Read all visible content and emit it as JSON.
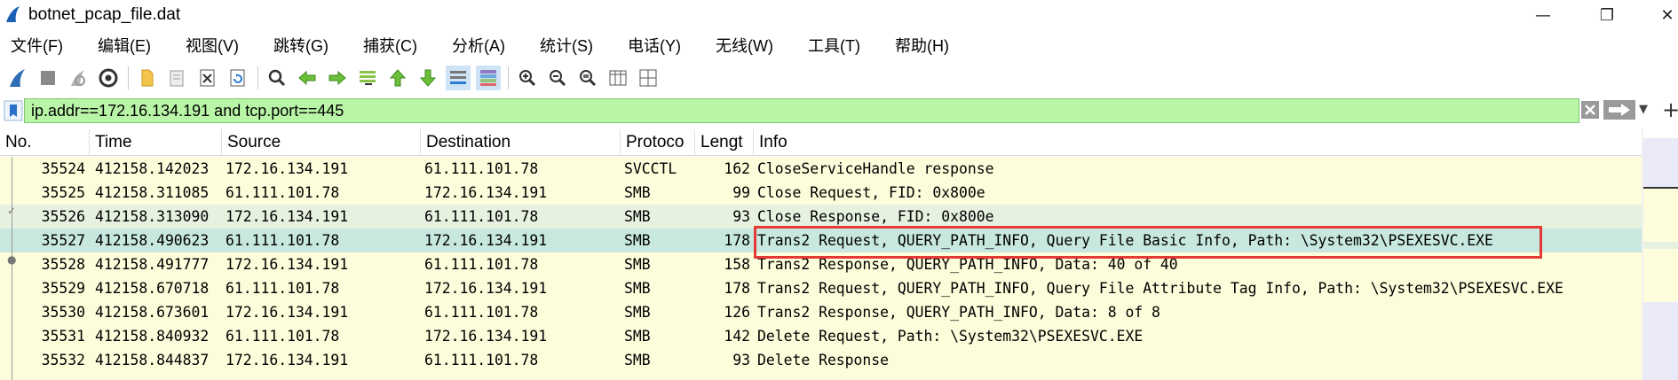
{
  "window": {
    "title": "botnet_pcap_file.dat",
    "minimize_label": "—",
    "maximize_label": "❐",
    "close_label": "✕"
  },
  "menu": [
    {
      "label": "文件(F)"
    },
    {
      "label": "编辑(E)"
    },
    {
      "label": "视图(V)"
    },
    {
      "label": "跳转(G)"
    },
    {
      "label": "捕获(C)"
    },
    {
      "label": "分析(A)"
    },
    {
      "label": "统计(S)"
    },
    {
      "label": "电话(Y)"
    },
    {
      "label": "无线(W)"
    },
    {
      "label": "工具(T)"
    },
    {
      "label": "帮助(H)"
    }
  ],
  "toolbar": {
    "icons": [
      "shark-fin-start-icon",
      "stop-capture-icon",
      "restart-capture-icon",
      "capture-options-icon",
      "open-file-icon",
      "file-set-icon",
      "close-file-icon",
      "reload-icon",
      "find-packet-icon",
      "go-back-icon",
      "go-forward-icon",
      "go-to-packet-icon",
      "first-packet-icon",
      "last-packet-icon",
      "auto-scroll-icon",
      "colorize-icon",
      "zoom-in-icon",
      "zoom-out-icon",
      "zoom-normal-icon",
      "resize-columns-icon",
      "expand-subtrees-icon"
    ]
  },
  "filter": {
    "value": "ip.addr==172.16.134.191 and tcp.port==445",
    "background": "#b9f5a6"
  },
  "columns": [
    {
      "label": "No."
    },
    {
      "label": "Time"
    },
    {
      "label": "Source"
    },
    {
      "label": "Destination"
    },
    {
      "label": "Protoco"
    },
    {
      "label": "Lengt"
    },
    {
      "label": "Info"
    }
  ],
  "packets": [
    {
      "no": "35524",
      "time": "412158.142023",
      "source": "172.16.134.191",
      "destination": "61.111.101.78",
      "protocol": "SVCCTL",
      "length": "162",
      "info": "CloseServiceHandle response"
    },
    {
      "no": "35525",
      "time": "412158.311085",
      "source": "61.111.101.78",
      "destination": "172.16.134.191",
      "protocol": "SMB",
      "length": "99",
      "info": "Close Request, FID: 0x800e"
    },
    {
      "no": "35526",
      "time": "412158.313090",
      "source": "172.16.134.191",
      "destination": "61.111.101.78",
      "protocol": "SMB",
      "length": "93",
      "info": "Close Response, FID: 0x800e"
    },
    {
      "no": "35527",
      "time": "412158.490623",
      "source": "61.111.101.78",
      "destination": "172.16.134.191",
      "protocol": "SMB",
      "length": "178",
      "info": "Trans2 Request, QUERY_PATH_INFO, Query File Basic Info, Path: \\System32\\PSEXESVC.EXE"
    },
    {
      "no": "35528",
      "time": "412158.491777",
      "source": "172.16.134.191",
      "destination": "61.111.101.78",
      "protocol": "SMB",
      "length": "158",
      "info": "Trans2 Response, QUERY_PATH_INFO, Data: 40 of 40"
    },
    {
      "no": "35529",
      "time": "412158.670718",
      "source": "61.111.101.78",
      "destination": "172.16.134.191",
      "protocol": "SMB",
      "length": "178",
      "info": "Trans2 Request, QUERY_PATH_INFO, Query File Attribute Tag Info, Path: \\System32\\PSEXESVC.EXE"
    },
    {
      "no": "35530",
      "time": "412158.673601",
      "source": "172.16.134.191",
      "destination": "61.111.101.78",
      "protocol": "SMB",
      "length": "126",
      "info": "Trans2 Response, QUERY_PATH_INFO, Data: 8 of 8"
    },
    {
      "no": "35531",
      "time": "412158.840932",
      "source": "61.111.101.78",
      "destination": "172.16.134.191",
      "protocol": "SMB",
      "length": "142",
      "info": "Delete Request, Path: \\System32\\PSEXESVC.EXE"
    },
    {
      "no": "35532",
      "time": "412158.844837",
      "source": "172.16.134.191",
      "destination": "61.111.101.78",
      "protocol": "SMB",
      "length": "93",
      "info": "Delete Response"
    }
  ],
  "selected_packet": "35527",
  "colors": {
    "row_default": "#fdfddb",
    "row_selected": "#c7e7df",
    "highlight_box": "#e53935"
  }
}
